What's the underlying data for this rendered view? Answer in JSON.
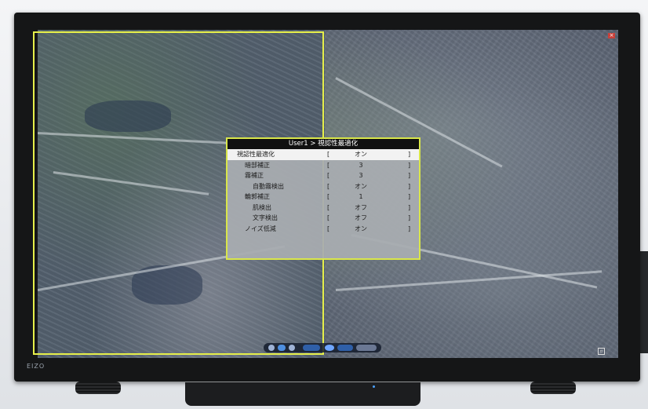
{
  "monitor": {
    "brand_logo": "EIZO"
  },
  "osd": {
    "title": "User1 > 視認性最適化",
    "rows": [
      {
        "label": "視認性最適化",
        "value": "オン",
        "selected": true
      },
      {
        "label": "暗部補正",
        "value": "3"
      },
      {
        "label": "霧補正",
        "value": "3"
      },
      {
        "label": "自動霧検出",
        "value": "オン"
      },
      {
        "label": "輪郭補正",
        "value": "1"
      },
      {
        "label": "肌検出",
        "value": "オフ"
      },
      {
        "label": "文字検出",
        "value": "オフ"
      },
      {
        "label": "ノイズ低減",
        "value": "オン"
      }
    ],
    "bracket_open": "[",
    "bracket_close": "]"
  },
  "colors": {
    "selection_frame": "#e6ef4a",
    "osd_border": "#d9e64a",
    "osd_title_bg": "#111111",
    "close_button": "#c8403a"
  }
}
